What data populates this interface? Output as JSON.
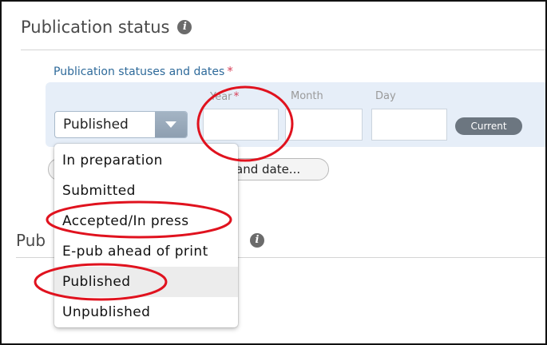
{
  "section": {
    "title": "Publication status",
    "title_partial": "Pub",
    "field_label": "Publication statuses and dates",
    "required_mark": "*"
  },
  "date_columns": {
    "year": "Year",
    "month": "Month",
    "day": "Day"
  },
  "status_select": {
    "value": "Published",
    "options": [
      "In preparation",
      "Submitted",
      "Accepted/In press",
      "E-pub ahead of print",
      "Published",
      "Unpublished"
    ],
    "highlighted_index": 4
  },
  "buttons": {
    "current": "Current",
    "add_status_partial": "and date..."
  },
  "colors": {
    "accent_label": "#2e6a9a",
    "required": "#d8425a",
    "annotation": "#e0121e",
    "panel": "#e6eef8"
  },
  "icons": [
    "info-icon",
    "chevron-down-icon"
  ]
}
